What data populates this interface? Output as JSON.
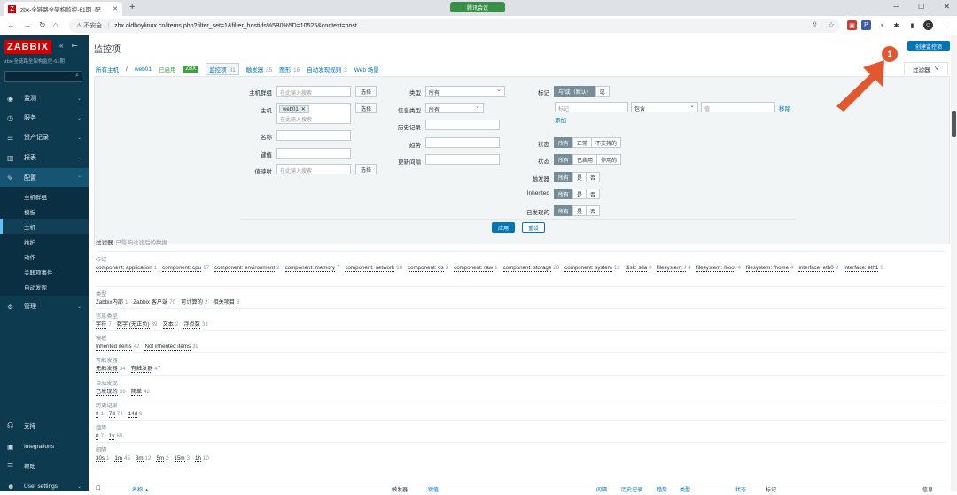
{
  "browser": {
    "tab_title": "zbx-全链路全架构监控-61期 ·配",
    "tab_favicon": "Z",
    "meeting_label": "腾讯会议",
    "security_label": "不安全",
    "url": "zbx.oldboylinux.cn/items.php?filter_set=1&filter_hostids%5B0%5D=10525&context=host"
  },
  "sidebar": {
    "logo": "ZABBIX",
    "subtitle": "zbx-全链路全架构监控-61期",
    "menu": [
      {
        "label": "监测",
        "icon": "eye-icon"
      },
      {
        "label": "服务",
        "icon": "clock-icon"
      },
      {
        "label": "资产记录",
        "icon": "list-icon"
      },
      {
        "label": "报表",
        "icon": "chart-icon"
      },
      {
        "label": "配置",
        "icon": "wrench-icon"
      },
      {
        "label": "管理",
        "icon": "gear-icon"
      }
    ],
    "submenu": [
      "主机群组",
      "模板",
      "主机",
      "维护",
      "动作",
      "关联项事件",
      "自动发现"
    ],
    "bottom": [
      "支持",
      "Integrations",
      "帮助",
      "User settings"
    ]
  },
  "header": {
    "title": "监控项",
    "create_button": "创建监控项",
    "filter_tab": "过滤器"
  },
  "breadcrumb": {
    "all_hosts": "所有主机",
    "slash": "/",
    "host": "web01",
    "enabled": "已启用",
    "zbx": "ZBX",
    "items": [
      {
        "label": "监控项",
        "count": "81"
      },
      {
        "label": "触发器",
        "count": "35"
      },
      {
        "label": "图形",
        "count": "16"
      },
      {
        "label": "自动发现规则",
        "count": "3"
      },
      {
        "label": "Web 场景",
        "count": ""
      }
    ]
  },
  "filter": {
    "host_groups_label": "主机群组",
    "host_groups_placeholder": "在此输入搜索",
    "hosts_label": "主机",
    "host_chip": "web01",
    "hosts_placeholder": "在此输入搜索",
    "select_label": "选择",
    "name_label": "名称",
    "key_label": "键值",
    "value_mapping_label": "值映射",
    "value_mapping_placeholder": "在此输入搜索",
    "type_label": "类型",
    "type_value": "所有",
    "info_type_label": "信息类型",
    "info_type_value": "所有",
    "history_label": "历史记录",
    "trends_label": "趋势",
    "update_interval_label": "更新间隔",
    "tags_label": "标记",
    "tags_and_or": "与/或（默认）",
    "tags_or": "或",
    "tag_placeholder": "标记",
    "tag_op": "包含",
    "tag_value_placeholder": "值",
    "remove_label": "移除",
    "add_label": "添加",
    "state_label": "状态",
    "state_opts": [
      "所有",
      "正常",
      "不支持的"
    ],
    "status_label": "状态",
    "status_opts": [
      "所有",
      "已启用",
      "停用的"
    ],
    "triggers_label": "触发器",
    "yn_opts": [
      "所有",
      "是",
      "否"
    ],
    "inherited_label": "Inherited",
    "discovered_label": "已发现的",
    "apply_label": "应用",
    "reset_label": "重设"
  },
  "subfilter": {
    "title": "过滤器",
    "note": "只影响过滤后的数据",
    "sections": [
      {
        "heading": "标记",
        "items": [
          [
            "component: application",
            "1"
          ],
          [
            "component: cpu",
            "17"
          ],
          [
            "component: environment",
            "2"
          ],
          [
            "component: memory",
            "7"
          ],
          [
            "component: network",
            "18"
          ],
          [
            "component: os",
            "3"
          ],
          [
            "component: raw",
            "1"
          ],
          [
            "component: storage",
            "23"
          ],
          [
            "component: system",
            "12"
          ],
          [
            "disk: sda",
            "8"
          ],
          [
            "filesystem: /",
            "4"
          ],
          [
            "filesystem: /boot",
            "4"
          ],
          [
            "filesystem: /home",
            "4"
          ],
          [
            "interface: eth0",
            "9"
          ],
          [
            "interface: eth1",
            "9"
          ]
        ]
      },
      {
        "heading": "类型",
        "items": [
          [
            "Zabbix内部",
            "1"
          ],
          [
            "Zabbix 客户端",
            "70"
          ],
          [
            "可计算的",
            "2"
          ],
          [
            "相关项目",
            "8"
          ]
        ]
      },
      {
        "heading": "信息类型",
        "items": [
          [
            "字符",
            "7"
          ],
          [
            "数字 (无正负)",
            "39"
          ],
          [
            "文本",
            "2"
          ],
          [
            "浮点数",
            "33"
          ]
        ]
      },
      {
        "heading": "模板",
        "items": [
          [
            "Inherited items",
            "42"
          ],
          [
            "Not inherited items",
            "39"
          ]
        ]
      },
      {
        "heading": "有触发器",
        "items": [
          [
            "无触发器",
            "34"
          ],
          [
            "有触发器",
            "47"
          ]
        ]
      },
      {
        "heading": "自动发现",
        "items": [
          [
            "已发现的",
            "39"
          ],
          [
            "简单",
            "42"
          ]
        ]
      },
      {
        "heading": "历史记录",
        "items": [
          [
            "0",
            "1"
          ],
          [
            "7d",
            "74"
          ],
          [
            "14d",
            "6"
          ]
        ]
      },
      {
        "heading": "趋势",
        "items": [
          [
            "0",
            "7"
          ],
          [
            "1y",
            "65"
          ]
        ]
      },
      {
        "heading": "间隔",
        "items": [
          [
            "30s",
            "1"
          ],
          [
            "1m",
            "45"
          ],
          [
            "3m",
            "12"
          ],
          [
            "5m",
            "2"
          ],
          [
            "15m",
            "3"
          ],
          [
            "1h",
            "10"
          ]
        ]
      }
    ]
  },
  "table": {
    "columns": [
      "名称 ▲",
      "触发器",
      "键值",
      "间隔",
      "历史记录",
      "趋势",
      "类型",
      "状态",
      "标记",
      "信息"
    ]
  },
  "annotation": {
    "badge": "1",
    "color": "#e2572f"
  },
  "colors": {
    "sidebar_bg": "#0e3a4f",
    "accent": "#0275b8",
    "logo_red": "#d40000"
  }
}
